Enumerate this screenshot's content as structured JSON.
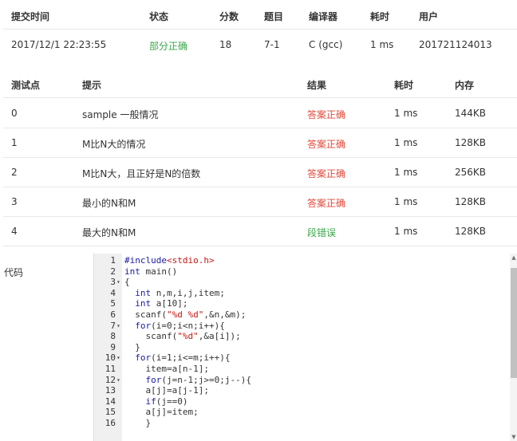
{
  "submission": {
    "headers": [
      "提交时间",
      "状态",
      "分数",
      "题目",
      "编译器",
      "耗时",
      "用户"
    ],
    "time": "2017/12/1 22:23:55",
    "status": "部分正确",
    "score": "18",
    "problem": "7-1",
    "compiler": "C (gcc)",
    "elapsed": "1 ms",
    "user": "201721124013",
    "status_color": "#3aa64a"
  },
  "tests": {
    "headers": [
      "测试点",
      "提示",
      "结果",
      "耗时",
      "内存"
    ],
    "rows": [
      {
        "id": "0",
        "hint": "sample 一般情况",
        "result": "答案正确",
        "time": "1 ms",
        "mem": "144KB"
      },
      {
        "id": "1",
        "hint": "M比N大的情况",
        "result": "答案正确",
        "time": "1 ms",
        "mem": "128KB"
      },
      {
        "id": "2",
        "hint": "M比N大，且正好是N的倍数",
        "result": "答案正确",
        "time": "1 ms",
        "mem": "256KB"
      },
      {
        "id": "3",
        "hint": "最小的N和M",
        "result": "答案正确",
        "time": "1 ms",
        "mem": "128KB"
      },
      {
        "id": "4",
        "hint": "最大的N和M",
        "result": "段错误",
        "time": "1 ms",
        "mem": "128KB"
      }
    ],
    "accepted_color": "#e24a3a",
    "error_color": "#3aa64a"
  },
  "code": {
    "label": "代码",
    "lines": [
      "#include<stdio.h>",
      "int main()",
      "{",
      "  int n,m,i,j,item;",
      "  int a[10];",
      "  scanf(\"%d %d\",&n,&m);",
      "  for(i=0;i<n;i++){",
      "    scanf(\"%d\",&a[i]);",
      "  }",
      "  for(i=1;i<=m;i++){",
      "    item=a[n-1];",
      "    for(j=n-1;j>=0;j--){",
      "    a[j]=a[j-1];",
      "    if(j==0)",
      "    a[j]=item;",
      "    }"
    ],
    "fold_lines": [
      3,
      7,
      10,
      12
    ]
  }
}
